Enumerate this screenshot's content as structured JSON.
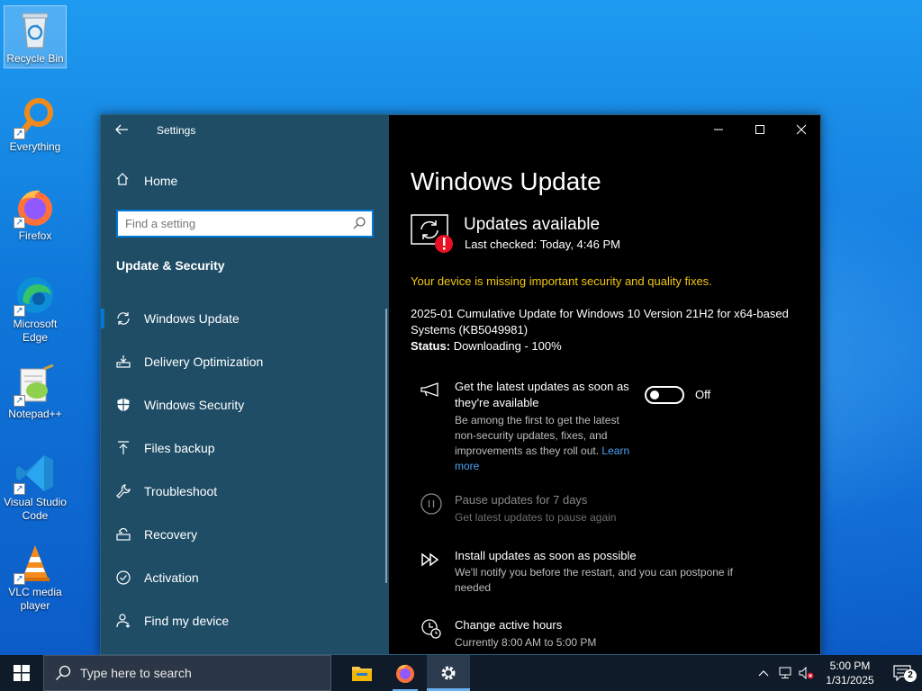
{
  "desktop": {
    "icons": [
      {
        "label": "Recycle Bin",
        "icon": "recycle-bin-icon"
      },
      {
        "label": "Everything",
        "icon": "everything-search-icon"
      },
      {
        "label": "Firefox",
        "icon": "firefox-icon"
      },
      {
        "label": "Microsoft Edge",
        "icon": "edge-icon"
      },
      {
        "label": "Notepad++",
        "icon": "notepadpp-icon"
      },
      {
        "label": "Visual Studio Code",
        "icon": "vscode-icon"
      },
      {
        "label": "VLC media player",
        "icon": "vlc-icon"
      }
    ]
  },
  "settings": {
    "app_title": "Settings",
    "home_label": "Home",
    "search_placeholder": "Find a setting",
    "section_title": "Update & Security",
    "nav_items": [
      {
        "label": "Windows Update",
        "icon": "sync-icon",
        "active": true
      },
      {
        "label": "Delivery Optimization",
        "icon": "delivery-optimization-icon"
      },
      {
        "label": "Windows Security",
        "icon": "shield-icon"
      },
      {
        "label": "Files backup",
        "icon": "backup-arrow-icon"
      },
      {
        "label": "Troubleshoot",
        "icon": "wrench-icon"
      },
      {
        "label": "Recovery",
        "icon": "recovery-icon"
      },
      {
        "label": "Activation",
        "icon": "check-circle-icon"
      },
      {
        "label": "Find my device",
        "icon": "person-location-icon"
      }
    ]
  },
  "content": {
    "page_title": "Windows Update",
    "status_title": "Updates available",
    "last_checked": "Last checked: Today, 4:46 PM",
    "warning": "Your device is missing important security and quality fixes.",
    "update_name": "2025-01 Cumulative Update for Windows 10 Version 21H2 for x64-based Systems (KB5049981)",
    "update_status_label": "Status:",
    "update_status_value": "Downloading - 100%",
    "options": {
      "latest": {
        "title": "Get the latest updates as soon as they're available",
        "desc": "Be among the first to get the latest non-security updates, fixes, and improvements as they roll out.",
        "link": "Learn more",
        "toggle_label": "Off"
      },
      "pause": {
        "title": "Pause updates for 7 days",
        "desc": "Get latest updates to pause again"
      },
      "install": {
        "title": "Install updates as soon as possible",
        "desc": "We'll notify you before the restart, and you can postpone if needed"
      },
      "active_hours": {
        "title": "Change active hours",
        "desc": "Currently 8:00 AM to 5:00 PM"
      }
    }
  },
  "taskbar": {
    "search_placeholder": "Type here to search",
    "time": "5:00 PM",
    "date": "1/31/2025",
    "notification_count": "2"
  },
  "colors": {
    "sidebar_bg": "#1f4d66",
    "content_bg": "#000000",
    "accent": "#0078d7",
    "warning": "#f2c811",
    "link": "#4aa3f0",
    "taskbar_bg": "#101b2a"
  }
}
